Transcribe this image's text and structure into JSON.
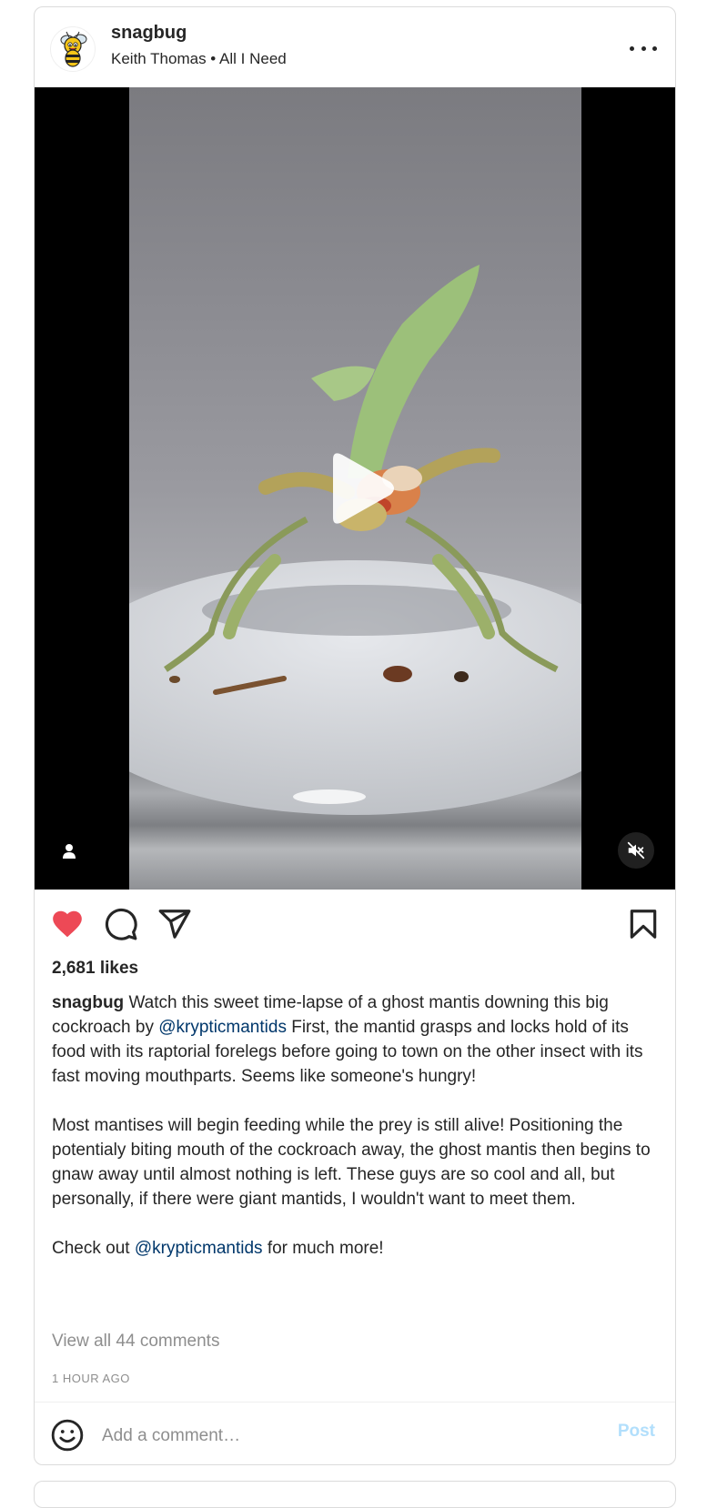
{
  "post": {
    "username": "snagbug",
    "subtitle": "Keith Thomas • All I Need",
    "avatar_icon": "bee-mascot-icon",
    "more_icon": "more-options-icon"
  },
  "media": {
    "play_icon": "play-icon",
    "user_tag_icon": "user-tag-icon",
    "mute_icon": "muted-speaker-icon"
  },
  "actions": {
    "like_icon": "heart-filled-icon",
    "like_color": "#ed4956",
    "comment_icon": "comment-icon",
    "share_icon": "share-icon",
    "save_icon": "bookmark-icon"
  },
  "likes": "2,681 likes",
  "caption": {
    "username": "snagbug",
    "p1_a": " Watch this sweet time-lapse of a ghost mantis downing this big cockroach by ",
    "mention1": "@krypticmantids",
    "p1_b": " First, the mantid grasps and locks hold of its food with its raptorial forelegs before going to town on the other insect with its fast moving mouthparts. Seems like someone's hungry!",
    "p2": "Most mantises will begin feeding while the prey is still alive! Positioning the potentialy biting mouth of the cockroach away, the ghost mantis then begins to gnaw away until almost nothing is left. These guys are so cool and all, but personally, if there were giant mantids, I wouldn't want to meet them.",
    "p3_a": "Check out ",
    "mention2": "@krypticmantids",
    "p3_b": " for much more!"
  },
  "view_comments": "View all 44 comments",
  "timestamp": "1 HOUR AGO",
  "comment_box": {
    "placeholder": "Add a comment…",
    "value": "",
    "post_label": "Post",
    "emoji_icon": "emoji-icon"
  },
  "colors": {
    "mention": "#00376b",
    "muted_text": "#8e8e8e",
    "post_disabled": "#b2dffc"
  }
}
